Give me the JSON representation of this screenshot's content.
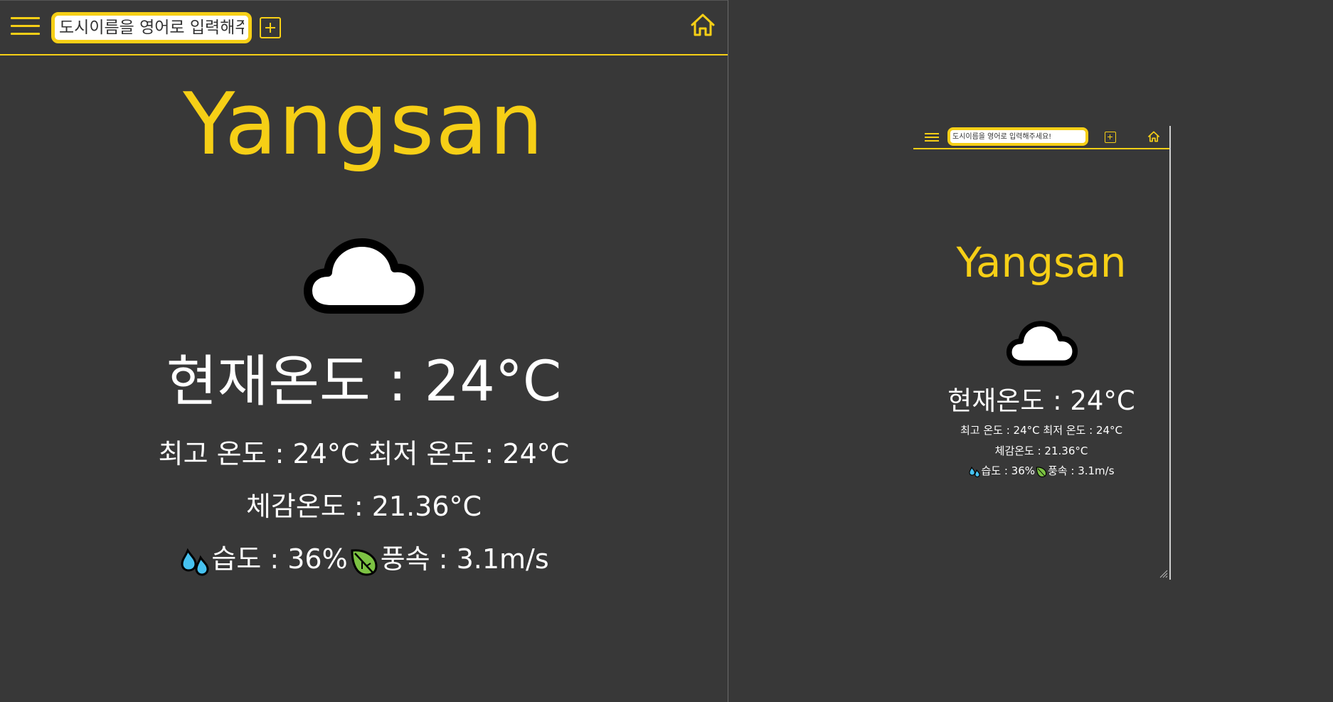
{
  "colors": {
    "accent": "#f6cf16",
    "background": "#383838",
    "text": "#ffffff"
  },
  "header": {
    "menu_icon": "hamburger-menu-icon",
    "search_placeholder": "도시이름을 영어로 입력해주세요!",
    "add_icon": "plus-square-icon",
    "home_icon": "home-icon"
  },
  "weather": {
    "city": "Yangsan",
    "condition_icon": "cloud-icon",
    "current_temp_label": "현재온도 : 24°C",
    "max_temp_label": "최고 온도 : 24°C",
    "min_temp_label": "최저 온도 : 24°C",
    "feels_like_label": "체감온도 : 21.36°C",
    "humidity_icon": "sweat-droplets-icon",
    "humidity_label": "습도 : 36%",
    "wind_icon": "leaf-wind-icon",
    "wind_label": "풍속 : 3.1m/s"
  }
}
